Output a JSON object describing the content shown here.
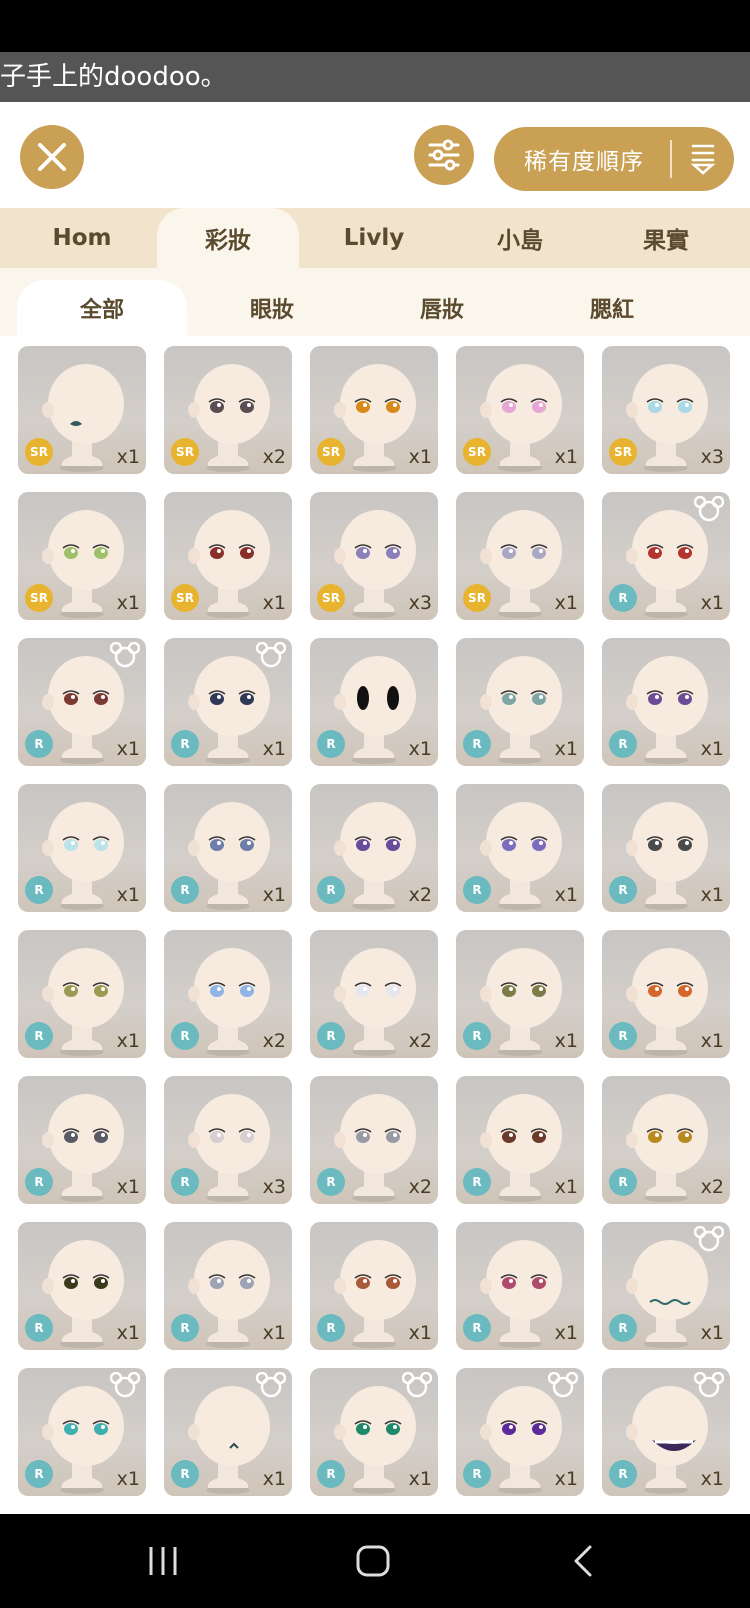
{
  "banner": {
    "text": "子手上的doodoo。"
  },
  "toolbar": {
    "close_icon": "close-icon",
    "filter_icon": "sliders-icon",
    "sort_label": "稀有度順序",
    "sort_icon": "sort-down-icon"
  },
  "category_tabs": [
    "Hom",
    "彩妝",
    "Livly",
    "小島",
    "果實"
  ],
  "active_category": 1,
  "sub_tabs": [
    "全部",
    "眼妝",
    "唇妝",
    "腮紅"
  ],
  "active_sub": 0,
  "colors": {
    "accent": "#c9a054",
    "sr": "#e8b32e",
    "r": "#6bbac0"
  },
  "items": [
    {
      "rarity": "SR",
      "count": "x1",
      "eye": "mouth-dark",
      "bear": false
    },
    {
      "rarity": "SR",
      "count": "x2",
      "eye": "#5b4d52",
      "bear": false
    },
    {
      "rarity": "SR",
      "count": "x1",
      "eye": "#d78a1a",
      "bear": false
    },
    {
      "rarity": "SR",
      "count": "x1",
      "eye": "#e5a6d6",
      "bear": false
    },
    {
      "rarity": "SR",
      "count": "x3",
      "eye": "#a9d9e6",
      "bear": false
    },
    {
      "rarity": "SR",
      "count": "x1",
      "eye": "#9fc06a",
      "bear": false
    },
    {
      "rarity": "SR",
      "count": "x1",
      "eye": "#8a2f2a",
      "bear": false
    },
    {
      "rarity": "SR",
      "count": "x3",
      "eye": "#8b80b9",
      "bear": false
    },
    {
      "rarity": "SR",
      "count": "x1",
      "eye": "#a9a7c4",
      "bear": false
    },
    {
      "rarity": "R",
      "count": "x1",
      "eye": "#b3352f",
      "bear": true
    },
    {
      "rarity": "R",
      "count": "x1",
      "eye": "#7a3a34",
      "bear": true
    },
    {
      "rarity": "R",
      "count": "x1",
      "eye": "#2f3a56",
      "bear": true
    },
    {
      "rarity": "R",
      "count": "x1",
      "eye": "big-black",
      "bear": false
    },
    {
      "rarity": "R",
      "count": "x1",
      "eye": "#7fa6a4",
      "bear": false
    },
    {
      "rarity": "R",
      "count": "x1",
      "eye": "#6b4c95",
      "bear": false
    },
    {
      "rarity": "R",
      "count": "x1",
      "eye": "#b9e2ea",
      "bear": false
    },
    {
      "rarity": "R",
      "count": "x1",
      "eye": "#6e7ea8",
      "bear": false
    },
    {
      "rarity": "R",
      "count": "x2",
      "eye": "#6a4a9a",
      "bear": false
    },
    {
      "rarity": "R",
      "count": "x1",
      "eye": "#7b6cc0",
      "bear": false
    },
    {
      "rarity": "R",
      "count": "x1",
      "eye": "#4a4a4a",
      "bear": false
    },
    {
      "rarity": "R",
      "count": "x1",
      "eye": "#9c9a52",
      "bear": false
    },
    {
      "rarity": "R",
      "count": "x2",
      "eye": "#8fb4e6",
      "bear": false
    },
    {
      "rarity": "R",
      "count": "x2",
      "eye": "#e6e6f0",
      "bear": false
    },
    {
      "rarity": "R",
      "count": "x1",
      "eye": "#7d7d4a",
      "bear": false
    },
    {
      "rarity": "R",
      "count": "x1",
      "eye": "#d4662a",
      "bear": false
    },
    {
      "rarity": "R",
      "count": "x1",
      "eye": "#5a5a66",
      "bear": false
    },
    {
      "rarity": "R",
      "count": "x3",
      "eye": "#d8cfd0",
      "bear": false
    },
    {
      "rarity": "R",
      "count": "x2",
      "eye": "#9a9aa6",
      "bear": false
    },
    {
      "rarity": "R",
      "count": "x1",
      "eye": "#6a3a2a",
      "bear": false
    },
    {
      "rarity": "R",
      "count": "x2",
      "eye": "#b88a20",
      "bear": false
    },
    {
      "rarity": "R",
      "count": "x1",
      "eye": "#3a3a1a",
      "bear": false
    },
    {
      "rarity": "R",
      "count": "x1",
      "eye": "#9da3b3",
      "bear": false
    },
    {
      "rarity": "R",
      "count": "x1",
      "eye": "#a85a3a",
      "bear": false
    },
    {
      "rarity": "R",
      "count": "x1",
      "eye": "#b04a6a",
      "bear": false
    },
    {
      "rarity": "R",
      "count": "x1",
      "eye": "mouth-wave",
      "bear": true
    },
    {
      "rarity": "R",
      "count": "x1",
      "eye": "#3fb0b0",
      "bear": true
    },
    {
      "rarity": "R",
      "count": "x1",
      "eye": "mouth-small",
      "bear": true
    },
    {
      "rarity": "R",
      "count": "x1",
      "eye": "#1f8a6a",
      "bear": true
    },
    {
      "rarity": "R",
      "count": "x1",
      "eye": "#5a2a9a",
      "bear": true
    },
    {
      "rarity": "R",
      "count": "x1",
      "eye": "mouth-grin",
      "bear": true
    }
  ],
  "nav": [
    "recent-apps-icon",
    "home-icon",
    "back-icon"
  ]
}
